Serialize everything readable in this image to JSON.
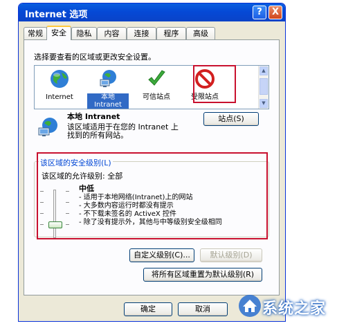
{
  "window": {
    "title": "Internet 选项",
    "help_symbol": "?",
    "close_symbol": "X",
    "colors": {
      "titlebar": "#0549d6",
      "dialog": "#ece9d8",
      "highlight_box": "#c8102e"
    }
  },
  "tabs": [
    {
      "label": "常规"
    },
    {
      "label": "安全"
    },
    {
      "label": "隐私"
    },
    {
      "label": "内容"
    },
    {
      "label": "连接"
    },
    {
      "label": "程序"
    },
    {
      "label": "高级"
    }
  ],
  "active_tab": "安全",
  "zones": {
    "prompt": "选择要查看的区域或更改安全设置。",
    "items": [
      {
        "label": "Internet",
        "icon": "globe-icon"
      },
      {
        "label": "本地\nIntranet",
        "icon": "intranet-icon",
        "selected": true
      },
      {
        "label": "可信站点",
        "icon": "checkmark-icon"
      },
      {
        "label": "受限站点",
        "icon": "restricted-icon"
      }
    ],
    "selected_title": "本地 Intranet",
    "description": "该区域适用于在您的 Intranet 上\n找到的所有网站。",
    "sites_button": "站点(S)"
  },
  "security_level": {
    "group_title": "该区域的安全级别(L)",
    "allowed": "该区域的允许级别: 全部",
    "level_name": "中低",
    "bullets": [
      "- 适用于本地网络(Intranet)上的网站",
      "- 大多数内容运行时都没有提示",
      "- 不下载未签名的 ActiveX 控件",
      "- 除了没有提示外，其他与中等级别安全级相同"
    ],
    "custom_button": "自定义级别(C)...",
    "default_button": "默认级别(D)"
  },
  "reset_all_button": "将所有区域重置为默认级别(R)",
  "footer": {
    "ok": "确定",
    "cancel": "取消"
  },
  "watermark": {
    "text": "系统之家",
    "icon": "house-logo-icon"
  }
}
